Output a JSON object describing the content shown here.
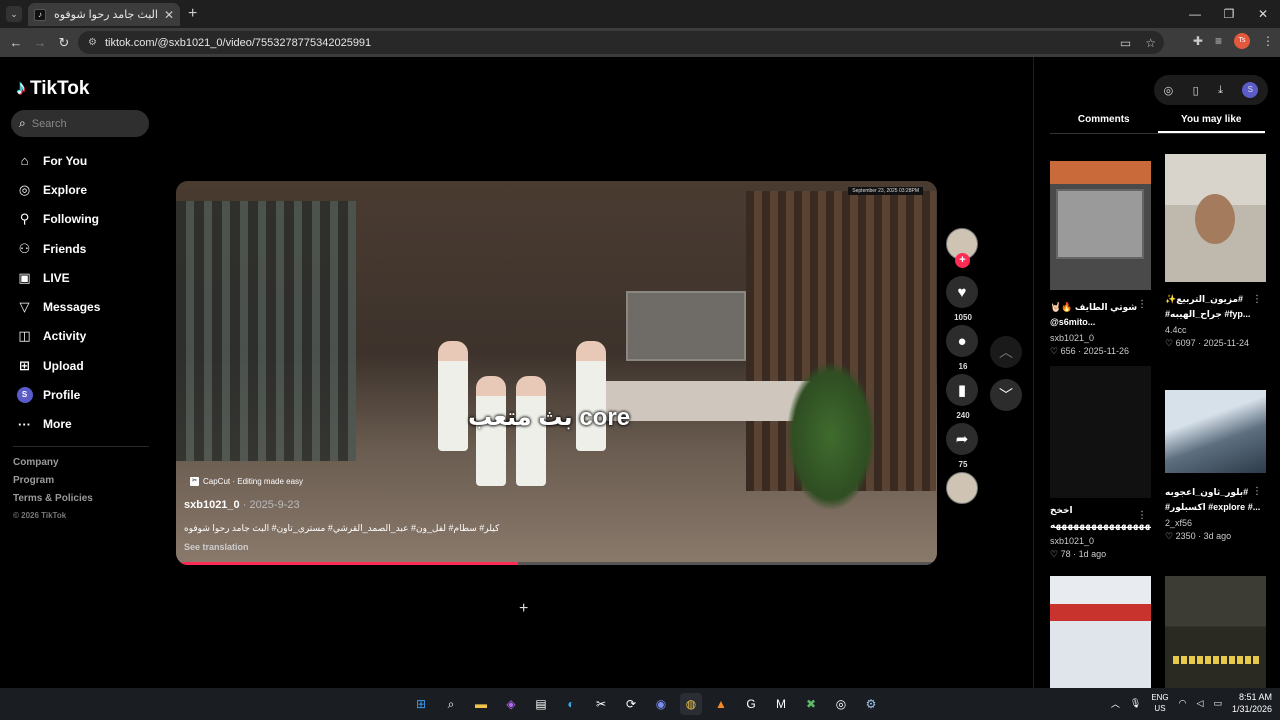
{
  "browser": {
    "tab_title": "البث جامد رحوا شوفوه #مسـ",
    "tab_close": "✕",
    "new_tab": "+",
    "url": "tiktok.com/@sxb1021_0/video/7553278775342025991",
    "profile_initials": "Ts"
  },
  "sidebar": {
    "logo_text": "TikTok",
    "search_placeholder": "Search",
    "nav": [
      {
        "label": "For You",
        "icon": "home-icon"
      },
      {
        "label": "Explore",
        "icon": "compass-icon"
      },
      {
        "label": "Following",
        "icon": "person-icon"
      },
      {
        "label": "Friends",
        "icon": "friends-icon"
      },
      {
        "label": "LIVE",
        "icon": "live-icon"
      },
      {
        "label": "Messages",
        "icon": "send-icon"
      },
      {
        "label": "Activity",
        "icon": "activity-icon"
      },
      {
        "label": "Upload",
        "icon": "plus-box-icon"
      },
      {
        "label": "Profile",
        "icon": "profile-avatar"
      },
      {
        "label": "More",
        "icon": "more-icon"
      }
    ],
    "profile_initial": "S",
    "footer": [
      "Company",
      "Program",
      "Terms & Policies",
      "© 2026 TikTok"
    ]
  },
  "video": {
    "timestamp_overlay": "September 23, 2025 03:28PM",
    "overlay_caption": "بث متعب core",
    "capcut_label": "CapCut · Editing made easy",
    "author": "sxb1021_0",
    "date": " · 2025-9-23",
    "description": "كيلر# سطام# لفل_ون# عبد_الصمد_القرشي# مستري_تاون# البث جامد رحوا شوفوه",
    "see_translation": "See translation",
    "progress": 0.45
  },
  "actions": {
    "likes": "1050",
    "comments": "16",
    "saves": "240",
    "shares": "75"
  },
  "right_panel": {
    "profile_initial": "S",
    "tab_comments": "Comments",
    "tab_you_may_like": "You may like",
    "cards": [
      {
        "title1": "شوتي الطايف 🔥🤘🏻",
        "title2": "@s6mito...",
        "user": "sxb1021_0",
        "meta": "♡ 656 · 2025-11-26"
      },
      {
        "title1": "#مزيون_التربيع✨",
        "title2": "#جراح_الهيبه #fyp...",
        "user": "4.4cc",
        "meta": "♡ 6097 · 2025-11-24"
      },
      {
        "title1": "اخخخ",
        "title2": "ههههههههههههههههههههه...",
        "user": "sxb1021_0",
        "meta": "♡ 78 · 1d ago"
      },
      {
        "title1": "#بلور_ثاون_اعجوبه",
        "title2": "#اكسبلور #explore #...",
        "user": "2_xf56",
        "meta": "♡ 2350 · 3d ago"
      }
    ]
  },
  "taskbar": {
    "lang1": "ENG",
    "lang2": "US",
    "time": "8:51 AM",
    "date": "1/31/2026"
  }
}
